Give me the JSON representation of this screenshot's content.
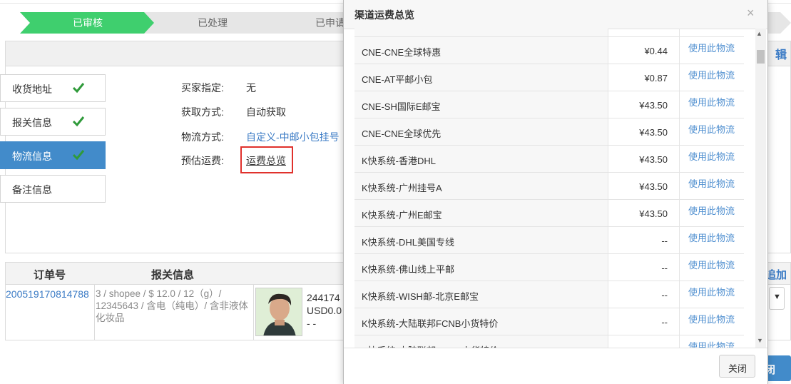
{
  "steps": [
    {
      "label": "已审核",
      "active": true
    },
    {
      "label": "已处理",
      "active": false
    },
    {
      "label": "已申请",
      "active": false
    }
  ],
  "header": {
    "edit_label": "辑"
  },
  "tabs": [
    {
      "label": "收货地址",
      "checked": true
    },
    {
      "label": "报关信息",
      "checked": true
    },
    {
      "label": "物流信息",
      "checked": true,
      "active": true
    },
    {
      "label": "备注信息",
      "checked": false
    }
  ],
  "form": {
    "buyer_label": "买家指定:",
    "buyer_value": "无",
    "acquire_label": "获取方式:",
    "acquire_value": "自动获取",
    "shipping_label": "物流方式:",
    "shipping_value": "自定义-中邮小包挂号",
    "freight_label": "预估运费:",
    "freight_link": "运费总览"
  },
  "order_table": {
    "col_order": "订单号",
    "col_customs": "报关信息",
    "add_label": "追加",
    "order_no": "200519170814788",
    "customs_info": "3 / shopee / $ 12.0 / 12（g）/ 12345643 / 含电（纯电）/ 含非液体化妆品",
    "product_line1": "244174",
    "product_line2": "USD0.0",
    "product_line3": "- -",
    "select_arrow": "▼",
    "close_label": "闭"
  },
  "modal": {
    "title": "渠道运费总览",
    "close_x": "×",
    "close_button": "关闭",
    "action_label": "使用此物流",
    "rows": [
      {
        "name": "CNE-CNE全球特惠",
        "price": "¥0.44"
      },
      {
        "name": "CNE-AT平邮小包",
        "price": "¥0.87"
      },
      {
        "name": "CNE-SH国际E邮宝",
        "price": "¥43.50"
      },
      {
        "name": "CNE-CNE全球优先",
        "price": "¥43.50"
      },
      {
        "name": "K快系统-香港DHL",
        "price": "¥43.50"
      },
      {
        "name": "K快系统-广州挂号A",
        "price": "¥43.50"
      },
      {
        "name": "K快系统-广州E邮宝",
        "price": "¥43.50"
      },
      {
        "name": "K快系统-DHL美国专线",
        "price": "--"
      },
      {
        "name": "K快系统-佛山线上平邮",
        "price": "--"
      },
      {
        "name": "K快系统-WISH邮-北京E邮宝",
        "price": "--"
      },
      {
        "name": "K快系统-大陆联邦FCNB小货特价",
        "price": "--"
      },
      {
        "name": "K快系统-大陆联邦FCNC小货特价",
        "price": "--"
      }
    ]
  },
  "colors": {
    "step_active": "#3fcf6e",
    "step_inactive": "#e6e6e6",
    "accent": "#428bca",
    "link": "#3b7bc5",
    "check": "#2f9a3a",
    "highlight_box": "#e0312c"
  }
}
